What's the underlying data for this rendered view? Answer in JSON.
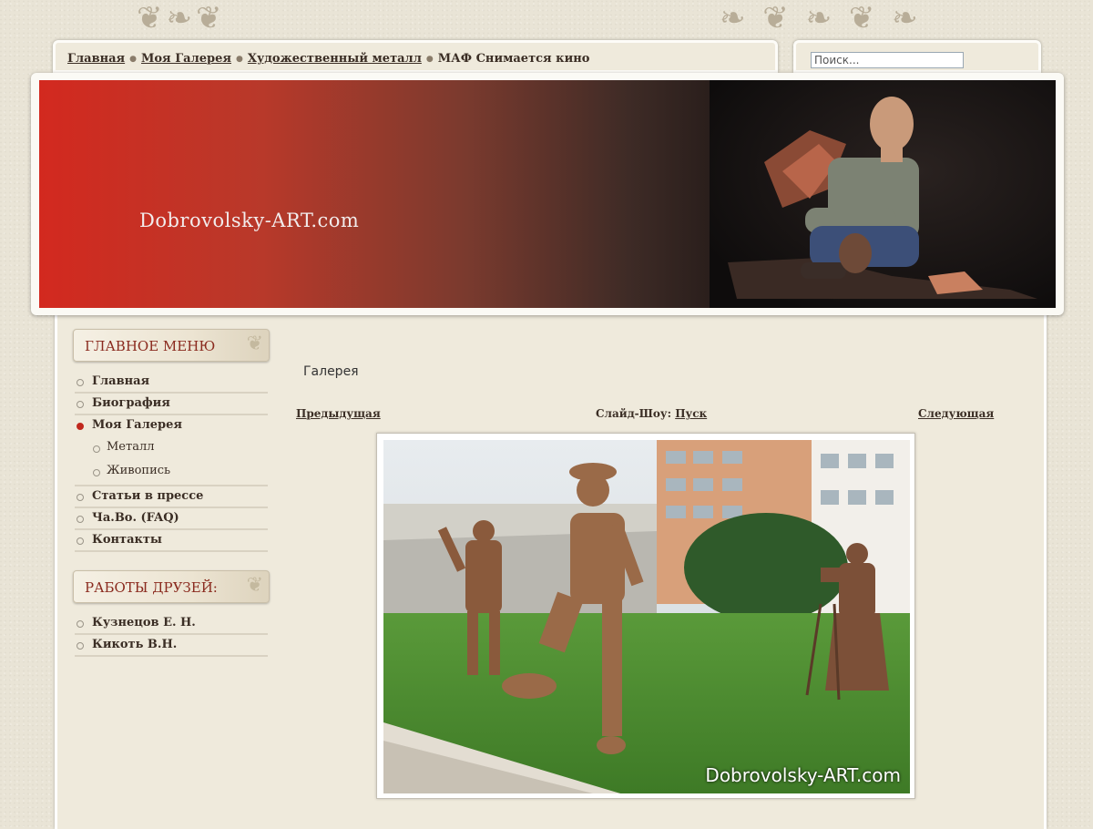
{
  "breadcrumb": {
    "items": [
      "Главная",
      "Моя Галерея",
      "Художественный металл"
    ],
    "current": "МАФ Снимается кино"
  },
  "search": {
    "placeholder": "Поиск..."
  },
  "banner": {
    "title": "Dobrovolsky-ART.com"
  },
  "main_menu": {
    "heading": "ГЛАВНОЕ МЕНЮ",
    "items": [
      {
        "label": "Главная"
      },
      {
        "label": "Биография"
      },
      {
        "label": "Моя Галерея"
      },
      {
        "label": "Металл"
      },
      {
        "label": "Живопись"
      },
      {
        "label": "Статьи в прессе"
      },
      {
        "label": "Ча.Во. (FAQ)"
      },
      {
        "label": "Контакты"
      }
    ]
  },
  "friends_menu": {
    "heading": "РАБОТЫ ДРУЗЕЙ:",
    "items": [
      {
        "label": "Кузнецов Е. Н."
      },
      {
        "label": "Кикоть В.Н."
      }
    ]
  },
  "gallery": {
    "title": "Галерея",
    "prev_label": "Предыдущая",
    "next_label": "Следующая",
    "slideshow_label": "Слайд-Шоу:",
    "slideshow_start": "Пуск",
    "watermark": "Dobrovolsky-ART.com"
  },
  "colors": {
    "accent_red": "#c0281d",
    "text_brown": "#3b2e25",
    "page_bg": "#e9e4d6"
  }
}
